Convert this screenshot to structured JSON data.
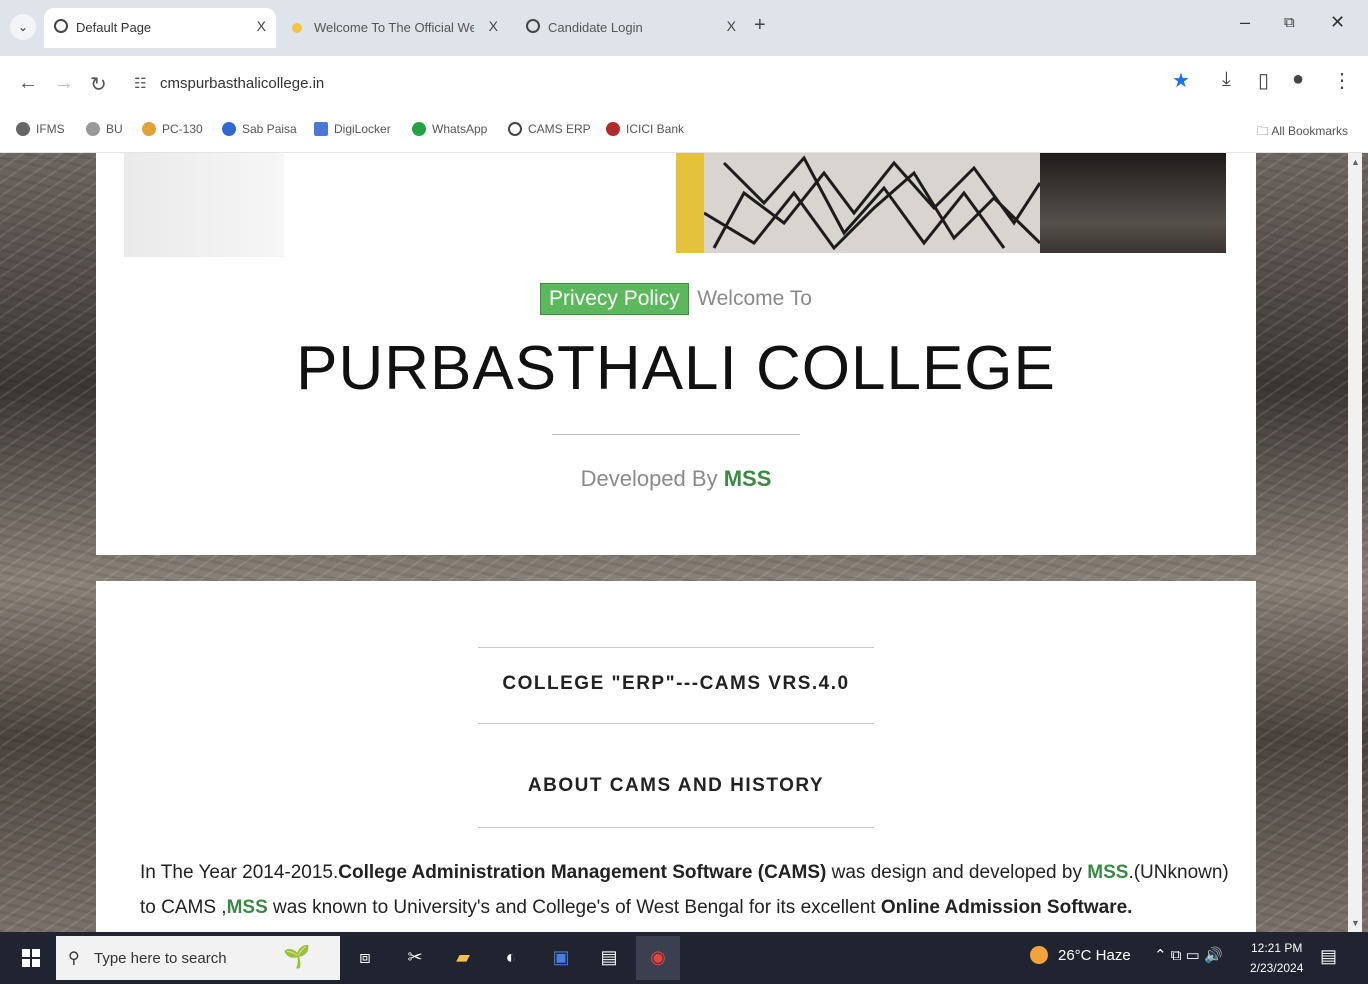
{
  "browser": {
    "tabs": [
      {
        "title": "Default Page",
        "close": "X"
      },
      {
        "title": "Welcome To The Official Websi",
        "close": "X"
      },
      {
        "title": "Candidate Login",
        "close": "X"
      }
    ],
    "new_tab": "+",
    "url": "cmspurbasthalicollege.in",
    "bookmarks": [
      "IFMS",
      "BU",
      "PC-130",
      "Sab Paisa",
      "DigiLocker",
      "WhatsApp",
      "CAMS ERP",
      "ICICI Bank"
    ],
    "all_bookmarks": "All Bookmarks"
  },
  "page": {
    "privacy_button": "Privecy Policy",
    "welcome": "Welcome To",
    "college_name": "PURBASTHALI COLLEGE",
    "developed_by": "Developed By",
    "developer": "MSS",
    "menu": {
      "erp_link": "COLLEGE \"ERP\"---CAMS VRS.4.0",
      "about_link": "ABOUT CAMS AND HISTORY"
    },
    "history": {
      "p1": "In The Year 2014-2015.",
      "b1": "College Administration Management Software (CAMS)",
      "p2": " was design and developed by ",
      "g1": "MSS",
      "p3": ".(UNknown) to CAMS ,",
      "g2": "MSS",
      "p4": " was known to University's and College's of West Bengal for its excellent ",
      "b2": "Online Admission Software."
    }
  },
  "taskbar": {
    "search_placeholder": "Type here to search",
    "weather": "26°C  Haze",
    "time": "12:21 PM",
    "date": "2/23/2024"
  }
}
